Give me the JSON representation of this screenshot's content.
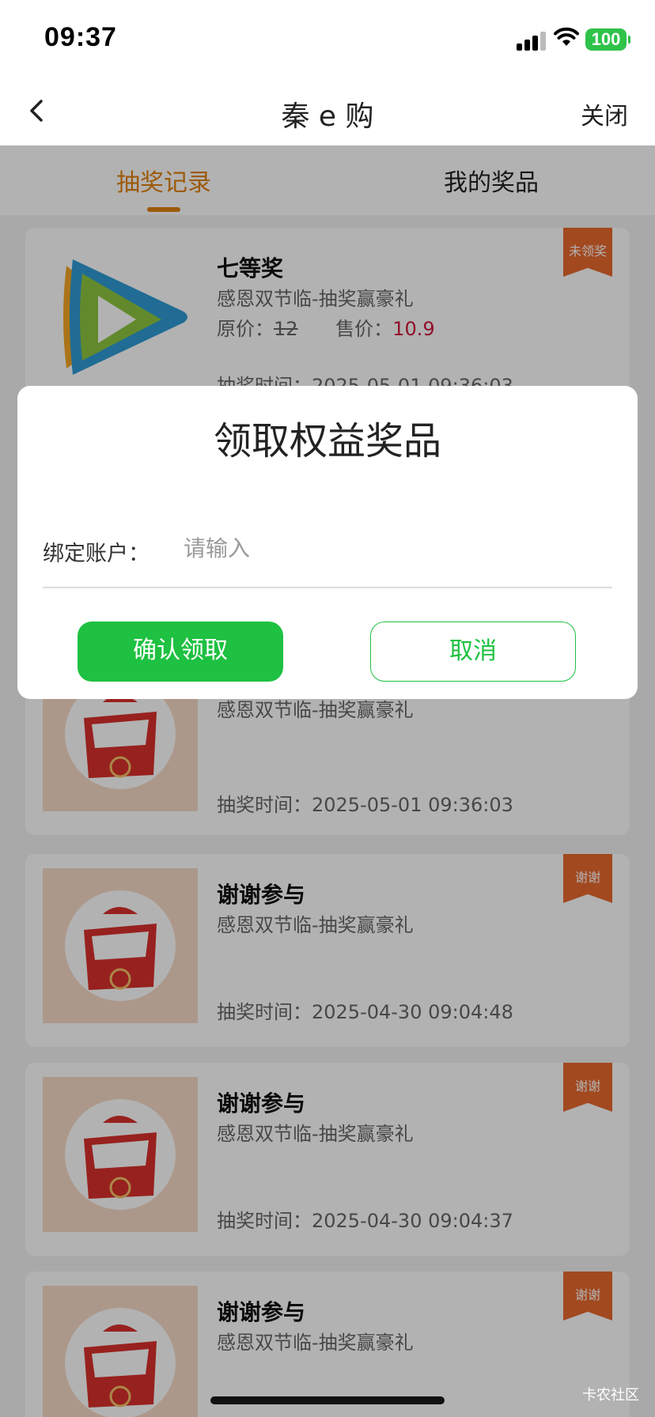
{
  "status_bar": {
    "time": "09:37",
    "battery": "100"
  },
  "nav": {
    "title": "秦 e 购",
    "close_label": "关闭"
  },
  "tabs": [
    {
      "label": "抽奖记录",
      "active": true
    },
    {
      "label": "我的奖品",
      "active": false
    }
  ],
  "records": [
    {
      "name": "七等奖",
      "subtitle": "感恩双节临-抽奖赢豪礼",
      "price_label": "原价：",
      "original_price": "12",
      "sale_label": "售价：",
      "sale_price": "10.9",
      "time": "抽奖时间：2025-05-01 09:36:03",
      "ribbon": "未领奖",
      "thumb": "video-app-logo"
    },
    {
      "name": "",
      "subtitle": "感恩双节临-抽奖赢豪礼",
      "time": "抽奖时间：2025-05-01 09:36:03",
      "thumb": "thanks-for-participating-icon"
    },
    {
      "name": "谢谢参与",
      "subtitle": "感恩双节临-抽奖赢豪礼",
      "time": "抽奖时间：2025-04-30 09:04:48",
      "ribbon": "谢谢",
      "thumb": "thanks-for-participating-icon"
    },
    {
      "name": "谢谢参与",
      "subtitle": "感恩双节临-抽奖赢豪礼",
      "time": "抽奖时间：2025-04-30 09:04:37",
      "ribbon": "谢谢",
      "thumb": "thanks-for-participating-icon"
    },
    {
      "name": "谢谢参与",
      "subtitle": "感恩双节临-抽奖赢豪礼",
      "ribbon": "谢谢",
      "thumb": "thanks-for-participating-icon"
    }
  ],
  "dialog": {
    "title": "领取权益奖品",
    "field_label": "绑定账户：",
    "field_placeholder": "请输入",
    "field_value": "",
    "confirm_label": "确认领取",
    "cancel_label": "取消"
  },
  "watermark": "卡农社区",
  "colors": {
    "accent_orange": "#e0820f",
    "confirm_green": "#1ec141",
    "sale_red": "#d0153c",
    "ribbon": "#e9692f"
  }
}
